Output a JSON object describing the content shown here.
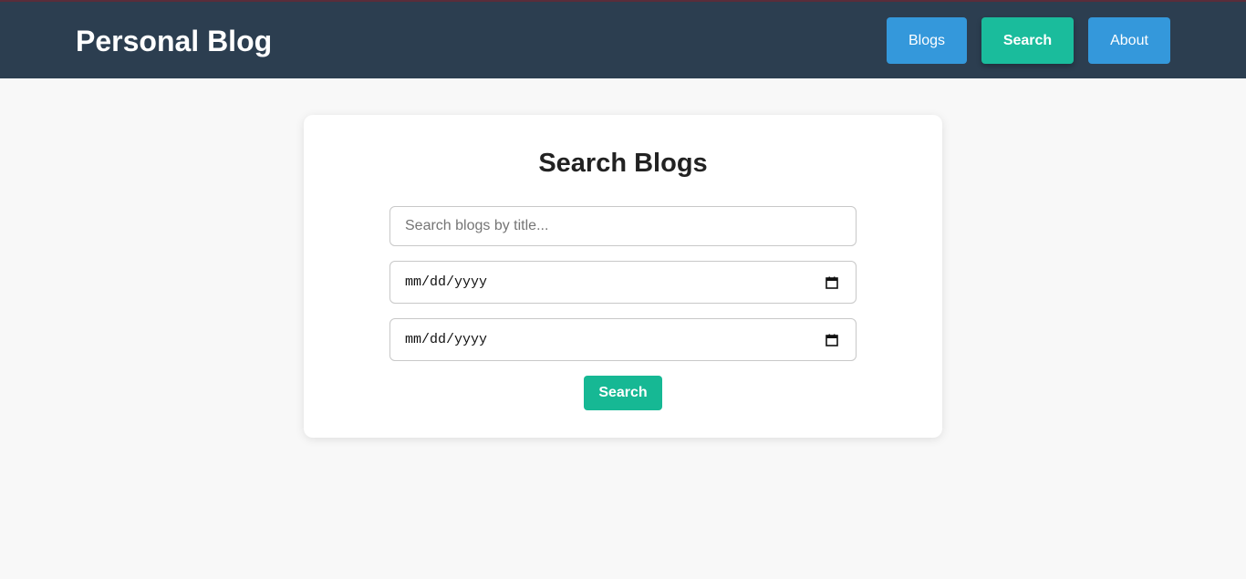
{
  "header": {
    "brand": "Personal Blog",
    "nav": {
      "blogs": "Blogs",
      "search": "Search",
      "about": "About"
    },
    "colors": {
      "background": "#2c3e50",
      "nav_button": "#3498db",
      "nav_active": "#1abc9c"
    }
  },
  "search_card": {
    "title": "Search Blogs",
    "title_input": {
      "placeholder": "Search blogs by title...",
      "value": ""
    },
    "start_date": {
      "display": "mm/dd/yyyy",
      "icon": "calendar-icon"
    },
    "end_date": {
      "display": "mm/dd/yyyy",
      "icon": "calendar-icon"
    },
    "submit_label": "Search",
    "colors": {
      "submit": "#16b894"
    }
  }
}
